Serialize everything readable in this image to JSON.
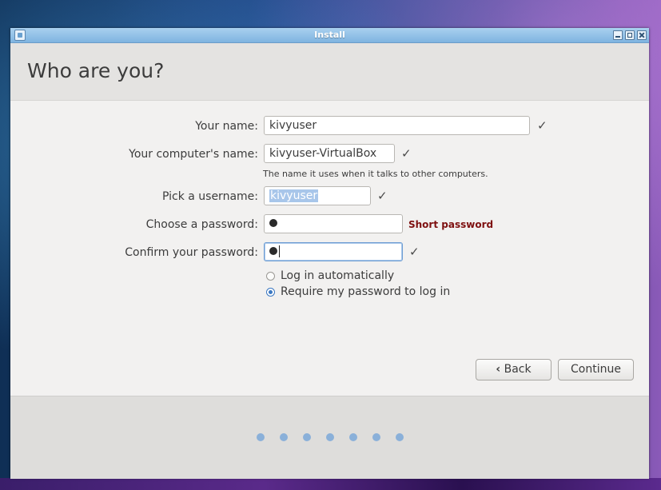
{
  "window": {
    "title": "Install"
  },
  "page": {
    "heading": "Who are you?"
  },
  "form": {
    "name_label": "Your name:",
    "name_value": "kivyuser",
    "computer_label": "Your computer's name:",
    "computer_value": "kivyuser-VirtualBox",
    "computer_hint": "The name it uses when it talks to other computers.",
    "username_label": "Pick a username:",
    "username_value": "kivyuser",
    "password_label": "Choose a password:",
    "password_warning": "Short password",
    "confirm_label": "Confirm your password:",
    "check_mark": "✓"
  },
  "login_options": {
    "auto_label": "Log in automatically",
    "require_label": "Require my password to log in",
    "selected": "require"
  },
  "buttons": {
    "back_label": "Back",
    "continue_label": "Continue"
  },
  "progress": {
    "total_steps": 7
  },
  "colors": {
    "warning": "#7e1010",
    "accent": "#3b78c2",
    "titlebar": "#8fc0e6"
  }
}
